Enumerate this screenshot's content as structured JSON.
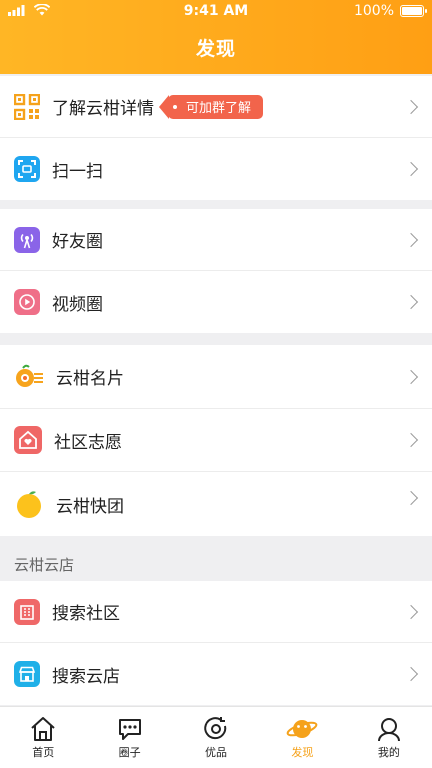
{
  "status_bar": {
    "time": "9:41 AM",
    "battery": "100%"
  },
  "header": {
    "title": "发现"
  },
  "group1": {
    "detail": {
      "label": "了解云柑详情",
      "badge": "可加群了解",
      "icon": "qrcode-icon"
    },
    "scan": {
      "label": "扫一扫",
      "icon": "scan-icon"
    }
  },
  "group2": {
    "friends": {
      "label": "好友圈",
      "icon": "broadcast-icon"
    },
    "video": {
      "label": "视频圈",
      "icon": "play-icon"
    }
  },
  "group3": {
    "card": {
      "label": "云柑名片",
      "icon": "orange-card-icon"
    },
    "volunteer": {
      "label": "社区志愿",
      "icon": "heart-house-icon"
    },
    "group_buy": {
      "label": "云柑快团",
      "icon": "orange-fruit-icon"
    }
  },
  "store_section": {
    "title": "云柑云店",
    "search_community": {
      "label": "搜索社区",
      "icon": "building-icon"
    },
    "search_store": {
      "label": "搜索云店",
      "icon": "store-icon"
    }
  },
  "tabbar": {
    "tabs": [
      {
        "label": "首页",
        "icon": "home-icon"
      },
      {
        "label": "圈子",
        "icon": "chat-icon"
      },
      {
        "label": "优品",
        "icon": "refresh-circle-icon"
      },
      {
        "label": "发现",
        "icon": "planet-icon",
        "active": true
      },
      {
        "label": "我的",
        "icon": "user-icon"
      }
    ]
  },
  "colors": {
    "accent": "#ff9f14",
    "badge": "#f2644b",
    "tab_active": "#f5a21b"
  }
}
